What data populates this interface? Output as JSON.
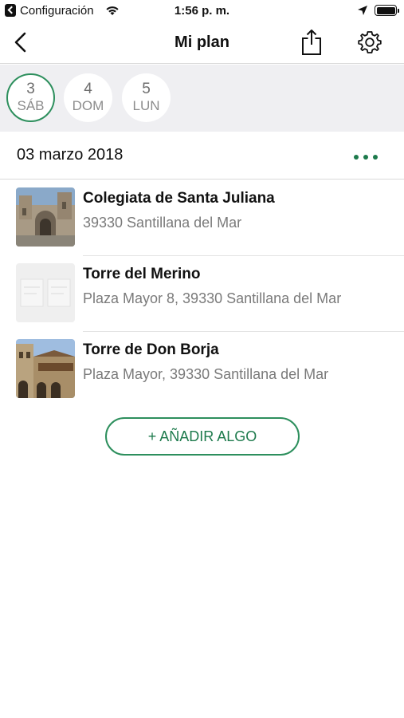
{
  "status_bar": {
    "back_app": "Configuración",
    "time": "1:56 p. m."
  },
  "nav": {
    "title": "Mi plan"
  },
  "days": [
    {
      "num": "3",
      "weekday": "SÁB",
      "selected": true
    },
    {
      "num": "4",
      "weekday": "DOM",
      "selected": false
    },
    {
      "num": "5",
      "weekday": "LUN",
      "selected": false
    }
  ],
  "date_header": {
    "label": "03 marzo 2018"
  },
  "places": [
    {
      "name": "Colegiata de Santa Juliana",
      "address": "39330 Santillana del Mar",
      "image": "church-photo"
    },
    {
      "name": "Torre del Merino",
      "address": "Plaza Mayor 8, 39330 Santillana del Mar",
      "image": "placeholder-map"
    },
    {
      "name": "Torre de Don Borja",
      "address": "Plaza Mayor, 39330 Santillana del Mar",
      "image": "tower-photo"
    }
  ],
  "add_button": {
    "label": "+ AÑADIR ALGO"
  },
  "colors": {
    "accent": "#1d7a4c",
    "accent_border": "#2d8f5d",
    "day_bar_bg": "#efeff2"
  }
}
